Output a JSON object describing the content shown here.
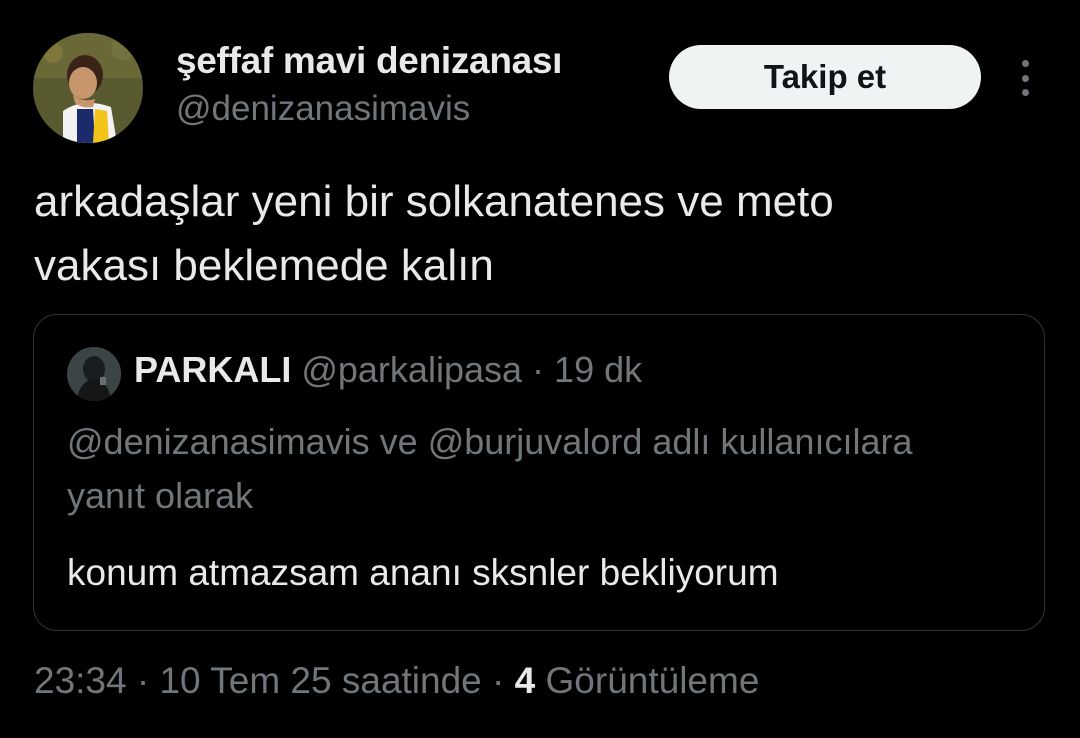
{
  "author": {
    "display_name": "şeffaf mavi denizanası",
    "handle": "@denizanasimavis",
    "avatar_icon": "profile-avatar-football-player"
  },
  "follow_button_label": "Takip et",
  "more_icon": "more-vertical-icon",
  "tweet": {
    "text": "arkadaşlar yeni bir solkanatenes ve meto\nvakası beklemede kalın"
  },
  "quoted": {
    "avatar_icon": "profile-avatar-hooded-figure",
    "name": "PARKALI",
    "handle": "@parkalipasa",
    "separator": "·",
    "time": "19 dk",
    "reply_context": "@denizanasimavis ve @burjuvalord adlı kullanıcılara yanıt olarak",
    "text": "konum atmazsam ananı sksnler bekliyorum"
  },
  "meta": {
    "time": "23:34",
    "separator": "·",
    "date": "10 Tem 25 saatinde",
    "separator2": "·",
    "views_count": "4",
    "views_label": "Görüntüleme"
  },
  "colors": {
    "background": "#000000",
    "primary_text": "#e7e9ea",
    "secondary_text": "#71767b",
    "border": "#2f3336",
    "button_bg": "#eff3f4"
  }
}
